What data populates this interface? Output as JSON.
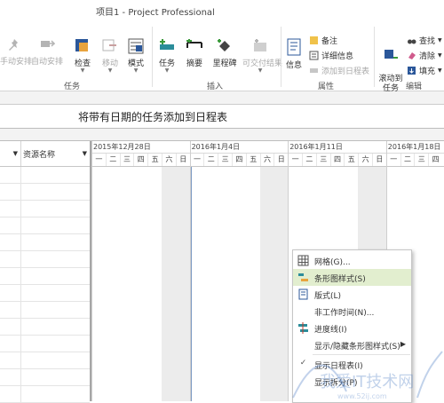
{
  "window": {
    "title": "项目1 - Project Professional"
  },
  "ribbon": {
    "buttons": {
      "manual": "手动安排",
      "auto": "自动安排",
      "inspect": "检查",
      "move": "移动",
      "mode": "模式",
      "task": "任务",
      "summary": "摘要",
      "milestone": "里程碑",
      "deliverable": "可交付结果",
      "info": "信息",
      "scroll_to_task": "滚动到\n任务"
    },
    "small": {
      "notes": "备注",
      "details": "详细信息",
      "add_to_timeline": "添加到日程表",
      "find": "查找",
      "clear": "清除",
      "fill": "填充"
    },
    "groups": {
      "tasks": "任务",
      "insert": "插入",
      "properties": "属性",
      "editing": "编辑"
    }
  },
  "timeline": {
    "text": "将带有日期的任务添加到日程表"
  },
  "table": {
    "columns": [
      "资源名称"
    ],
    "column_filter_icon": "dropdown-arrow-icon"
  },
  "gantt": {
    "weeks": [
      "2015年12月28日",
      "2016年1月4日",
      "2016年1月11日",
      "2016年1月18日"
    ],
    "days": [
      "一",
      "二",
      "三",
      "四",
      "五",
      "六",
      "日",
      "一",
      "二",
      "三",
      "四",
      "五",
      "六",
      "日",
      "一",
      "二",
      "三",
      "四",
      "五",
      "六",
      "日",
      "一",
      "二",
      "三",
      "四"
    ]
  },
  "context_menu": {
    "items": [
      {
        "label": "网格(G)...",
        "icon": "grid-icon"
      },
      {
        "label": "条形图样式(S)",
        "icon": "bar-style-icon",
        "highlighted": true
      },
      {
        "label": "版式(L)",
        "icon": "layout-icon"
      },
      {
        "label": "非工作时间(N)...",
        "icon": ""
      },
      {
        "label": "进度线(I)",
        "icon": "progress-line-icon"
      },
      {
        "label": "显示/隐藏条形图样式(S)",
        "icon": "",
        "submenu": true
      },
      {
        "label": "显示日程表(I)",
        "icon": "check-icon"
      },
      {
        "label": "显示拆分(P)",
        "icon": ""
      }
    ]
  },
  "colors": {
    "accent": "#2b579a",
    "highlight": "#e2eecf",
    "weekend": "#ececec"
  }
}
